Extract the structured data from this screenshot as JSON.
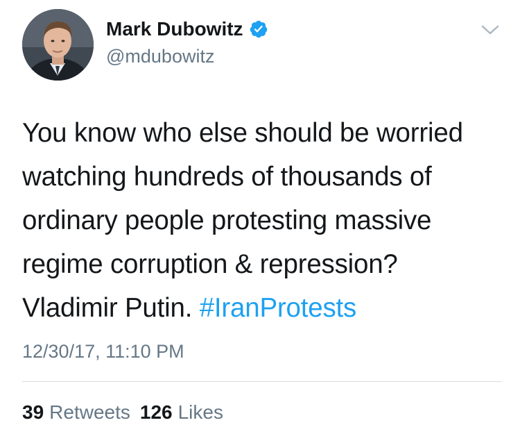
{
  "tweet": {
    "author": {
      "display_name": "Mark Dubowitz",
      "handle": "@mdubowitz",
      "verified_icon": "verified-badge-icon",
      "avatar": "profile-photo"
    },
    "menu_icon": "chevron-down-icon",
    "text_lines": [
      "You know who else should be worried",
      "watching hundreds of thousands of",
      "ordinary people protesting massive",
      "regime corruption & repression?",
      "Vladimir Putin."
    ],
    "hashtag": "#IranProtests",
    "timestamp": "12/30/17, 11:10 PM",
    "stats": {
      "retweets_count": "39",
      "retweets_label": "Retweets",
      "likes_count": "126",
      "likes_label": "Likes"
    }
  },
  "colors": {
    "text": "#14171a",
    "secondary": "#657786",
    "link": "#1da1f2",
    "verified": "#1da1f2",
    "divider": "#d8dde2"
  }
}
